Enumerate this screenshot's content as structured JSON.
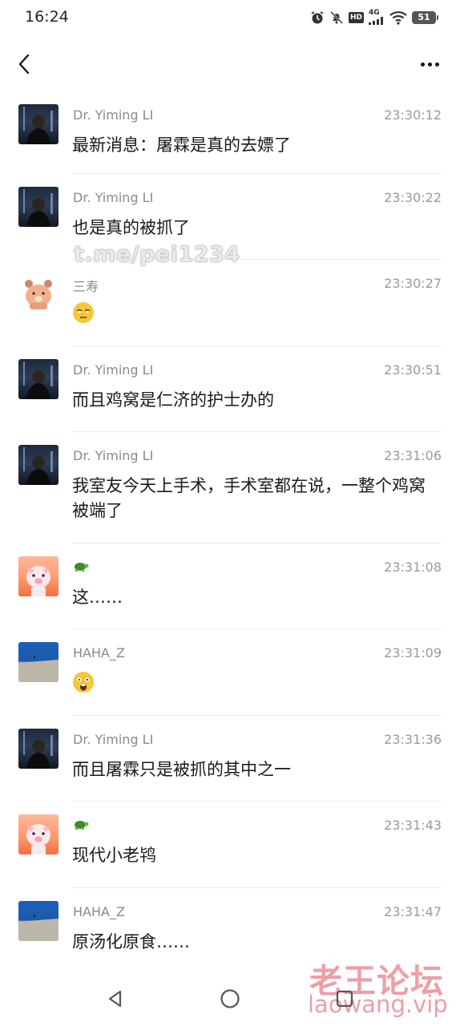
{
  "status_bar": {
    "time": "16:24",
    "network": "4G",
    "hd": "HD",
    "battery": "51"
  },
  "watermarks": {
    "overlay": "t.me/pei1234",
    "site_cn": "老王论坛",
    "site_url": "laowang.vip"
  },
  "messages": [
    {
      "sender": "Dr. Yiming LI",
      "time": "23:30:12",
      "text": "最新消息：屠霖是真的去嫖了",
      "avatar": "doctor-avatar"
    },
    {
      "sender": "Dr. Yiming LI",
      "time": "23:30:22",
      "text": "也是真的被抓了",
      "avatar": "doctor-avatar"
    },
    {
      "sender": "三寿",
      "time": "23:30:27",
      "text": "",
      "emoji": "squint-face-emoji",
      "avatar": "bear-avatar"
    },
    {
      "sender": "Dr. Yiming LI",
      "time": "23:30:51",
      "text": "而且鸡窝是仁济的护士办的",
      "avatar": "doctor-avatar"
    },
    {
      "sender": "Dr. Yiming LI",
      "time": "23:31:06",
      "text": "我室友今天上手术，手术室都在说，一整个鸡窝被端了",
      "avatar": "doctor-avatar"
    },
    {
      "sender": "",
      "sender_icon": "turtle-emoji",
      "time": "23:31:08",
      "text": "这……",
      "avatar": "pig-avatar"
    },
    {
      "sender": "HAHA_Z",
      "time": "23:31:09",
      "text": "",
      "emoji": "shocked-face-emoji",
      "avatar": "sky-wall-avatar"
    },
    {
      "sender": "Dr. Yiming LI",
      "time": "23:31:36",
      "text": "而且屠霖只是被抓的其中之一",
      "avatar": "doctor-avatar"
    },
    {
      "sender": "",
      "sender_icon": "turtle-emoji",
      "time": "23:31:43",
      "text": "现代小老鸨",
      "avatar": "pig-avatar"
    },
    {
      "sender": "HAHA_Z",
      "time": "23:31:47",
      "text": "原汤化原食……",
      "avatar": "sky-wall-avatar"
    }
  ],
  "icons": {
    "back": "back-arrow-icon",
    "more": "more-dots-icon",
    "nav_back": "triangle-back-icon",
    "nav_home": "circle-home-icon",
    "nav_recent": "square-recent-icon"
  }
}
